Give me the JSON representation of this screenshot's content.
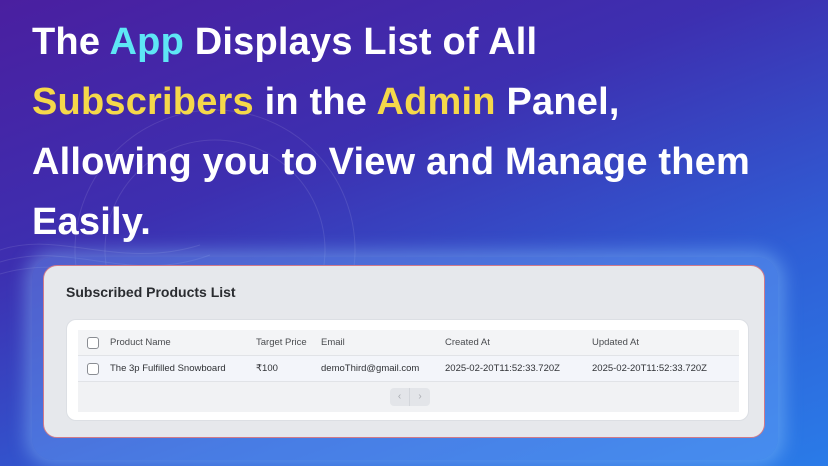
{
  "headline": {
    "line1_a": "The ",
    "line1_b": "App",
    "line1_c": " Displays List of All",
    "line2_a": "Subscribers",
    "line2_b": " in the ",
    "line2_c": "Admin",
    "line2_d": " Panel,",
    "line3": "Allowing you to View and Manage them",
    "line4": "Easily."
  },
  "colors": {
    "accent_cyan": "#5ee6f5",
    "accent_yellow": "#f5d84a"
  },
  "panel": {
    "title": "Subscribed Products List",
    "columns": [
      "Product Name",
      "Target Price",
      "Email",
      "Created At",
      "Updated At"
    ],
    "rows": [
      {
        "product": "The 3p Fulfilled Snowboard",
        "price": "₹100",
        "email": "demoThird@gmail.com",
        "created": "2025-02-20T11:52:33.720Z",
        "updated": "2025-02-20T11:52:33.720Z"
      }
    ],
    "pager": {
      "prev": "‹",
      "next": "›"
    }
  }
}
